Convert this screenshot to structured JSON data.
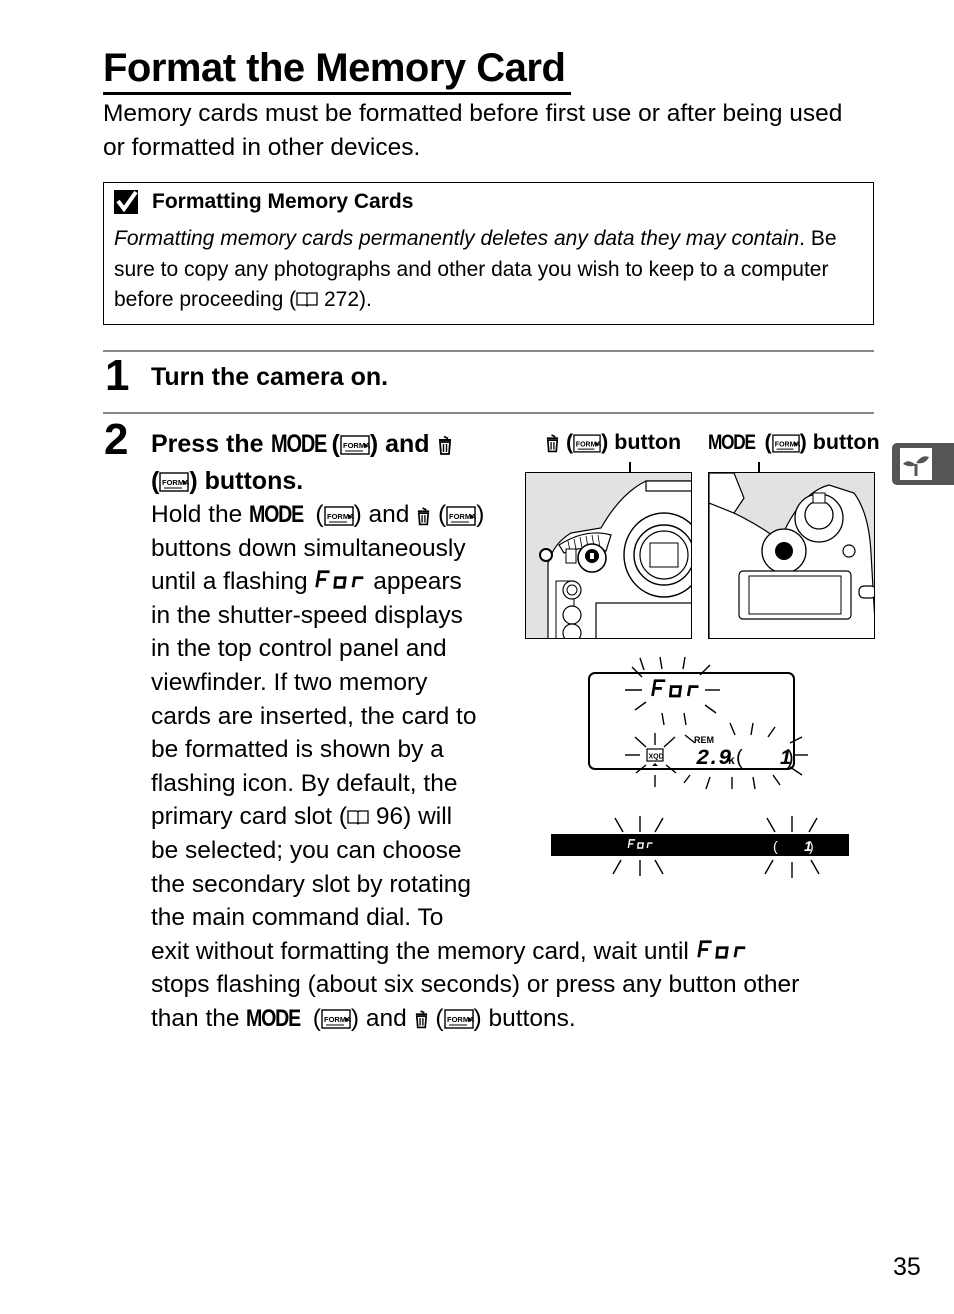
{
  "page": {
    "title": "Format the Memory Card",
    "intro": "Memory cards must be formatted before first use or after being used or formatted in other devices.",
    "page_number": "35",
    "side_tab_icon": "sprout-icon"
  },
  "note": {
    "icon": "checkmark-icon",
    "heading": "Formatting Memory Cards",
    "italic_text": "Formatting memory cards permanently deletes any data they may contain",
    "body_after_italic": ". Be sure to copy any photographs and other data you wish to keep to a computer before proceeding (",
    "ref_page": "272",
    "ref_close": ")."
  },
  "steps": [
    {
      "number": "1",
      "heading": "Turn the camera on."
    },
    {
      "number": "2",
      "heading_parts": {
        "press_the": "Press the",
        "mode": "MODE",
        "open": "(",
        "close_and": ") and",
        "open2": "(",
        "buttons": ") buttons."
      },
      "body": {
        "l1_a": "Hold the",
        "l1_mode": "MODE",
        "l1_b": "(",
        "l1_c": ") and",
        "l1_d": "(",
        "l1_e": ")",
        "l2": "buttons down simultaneously",
        "l3_a": "until a flashing",
        "l3_seg": "For",
        "l3_b": "appears",
        "l4": "in the shutter-speed displays",
        "l5": "in the top control panel and",
        "l6": "viewfinder.  If two memory",
        "l7": "cards are inserted, the card to",
        "l8": "be formatted is shown by a",
        "l9": "flashing icon.  By default, the",
        "l10_a": "primary card slot (",
        "l10_ref": "96",
        "l10_b": ") will",
        "l11": "be selected; you can choose",
        "l12": "the secondary slot by rotating",
        "l13": "the main command dial.  To",
        "l14_a": "exit without formatting the memory card, wait until",
        "l14_seg": "For",
        "l15": "stops flashing (about six seconds) or press any button other",
        "l16_a": "than the",
        "l16_mode": "MODE",
        "l16_b": "(",
        "l16_c": ") and",
        "l16_d": "(",
        "l16_e": ") buttons."
      }
    }
  ],
  "figures": {
    "delete_button_label": {
      "open": "(",
      "close": ") button"
    },
    "mode_button_label": {
      "mode": "MODE",
      "open": "(",
      "close": ") button"
    },
    "control_panel": {
      "shutter_display": "For",
      "rem_label": "REM",
      "remaining": "2.9",
      "remaining_unit": "k",
      "card_icon": "XQD",
      "bracket_value": "1"
    },
    "viewfinder": {
      "shutter_display": "For",
      "bracket_value": "1"
    }
  }
}
